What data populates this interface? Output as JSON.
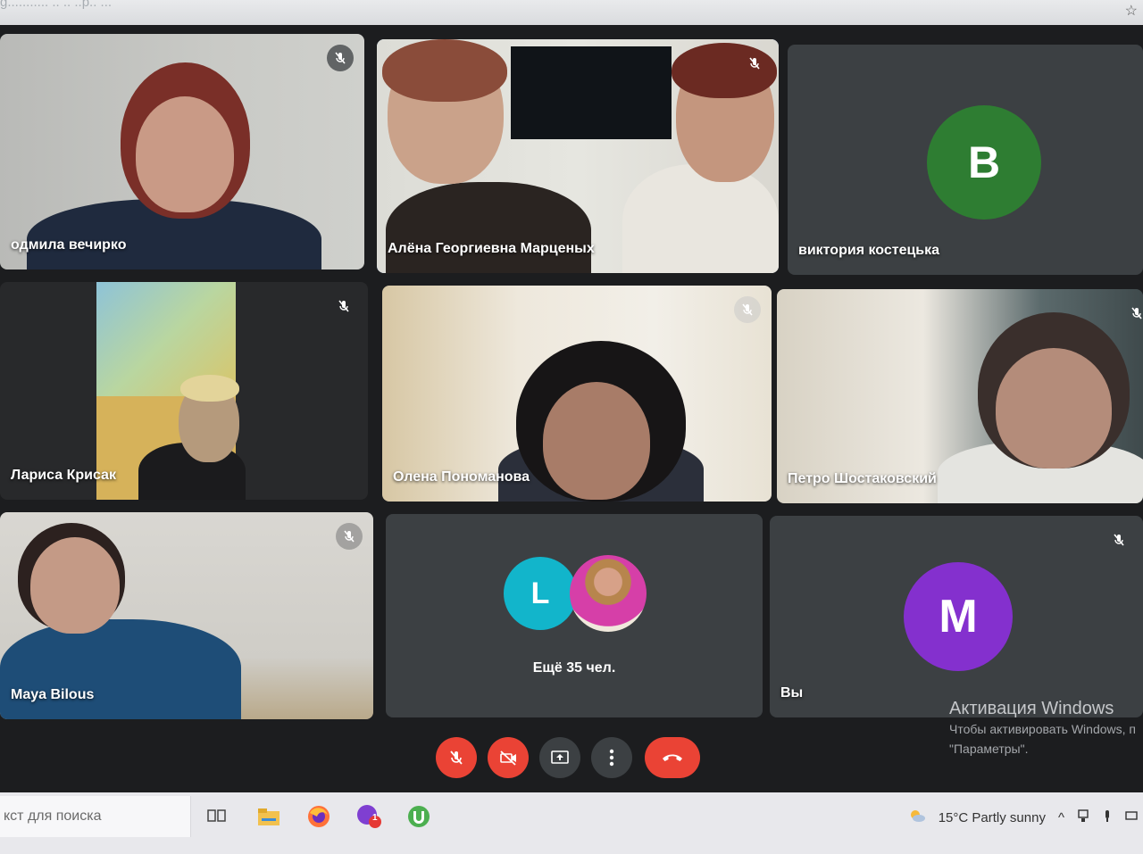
{
  "browser": {
    "url_fragment": "g........... .. .. ..p.. ..."
  },
  "participants": [
    {
      "name": "одмила вечирко",
      "muted": true
    },
    {
      "name": "Алёна Георгиевна Марценых",
      "muted": true,
      "active": true
    },
    {
      "name": "виктория костецька",
      "avatar_letter": "В",
      "avatar_color": "#2e7d32",
      "muted": false
    },
    {
      "name": "Лариса Крисак",
      "muted": true
    },
    {
      "name": "Олена Пономанова",
      "muted": true
    },
    {
      "name": "Петро Шостаковский",
      "muted": true
    },
    {
      "name": "Maya Bilous",
      "muted": true
    },
    {
      "name": "Вы",
      "avatar_letter": "M",
      "avatar_color": "#8430ce",
      "muted": true
    }
  ],
  "more_tile": {
    "label": "Ещё 35 чел.",
    "avatar_letter": "L",
    "avatar_color": "#12b5cb"
  },
  "windows_activation": {
    "title": "Активация Windows",
    "line1": "Чтобы активировать Windows, п",
    "line2": "\"Параметры\"."
  },
  "controls": {
    "mic": "mic-off-icon",
    "camera": "camera-off-icon",
    "present": "present-screen-icon",
    "more": "more-vert-icon",
    "leave": "hang-up-icon"
  },
  "taskbar": {
    "search_text": "кст для поиска",
    "weather": "15°C  Partly sunny",
    "badge_count": "1"
  },
  "colors": {
    "accent": "#8ab4f8",
    "danger": "#ea4335",
    "tile": "#3c4043"
  }
}
